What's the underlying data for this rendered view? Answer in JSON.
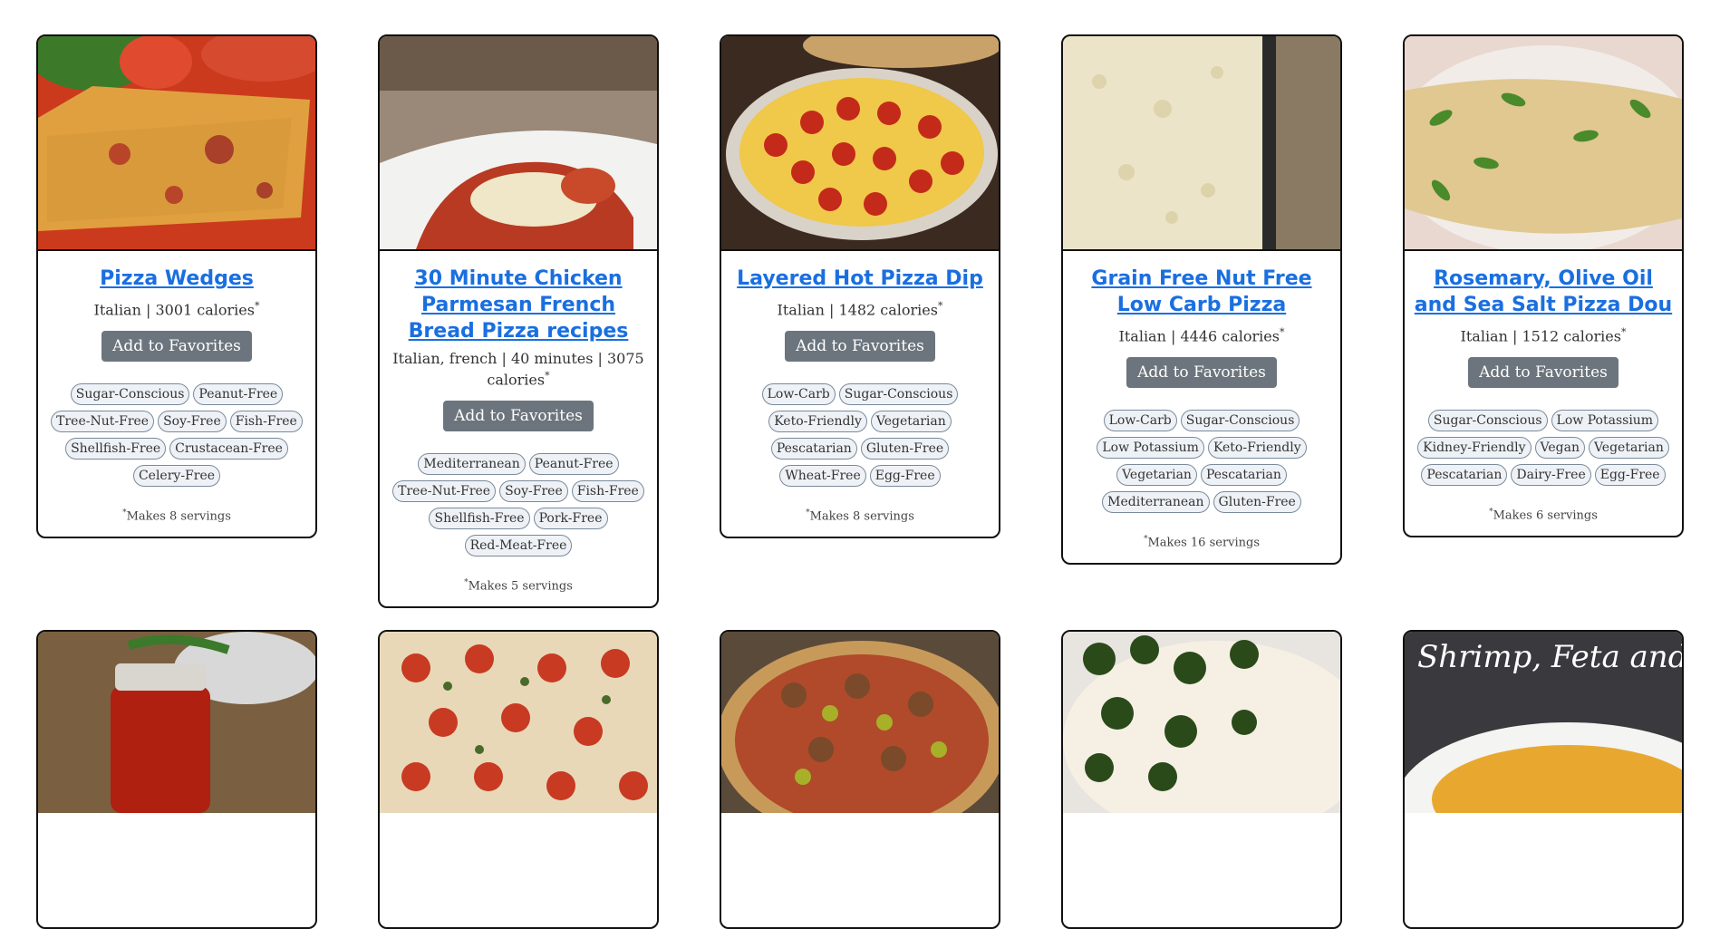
{
  "favorites_label": "Add to Favorites",
  "row1": [
    {
      "title": "Pizza Wedges",
      "meta": "Italian | 3001 calories",
      "tags": [
        "Sugar-Conscious",
        "Peanut-Free",
        "Tree-Nut-Free",
        "Soy-Free",
        "Fish-Free",
        "Shellfish-Free",
        "Crustacean-Free",
        "Celery-Free"
      ],
      "note": "Makes 8 servings"
    },
    {
      "title": "30 Minute Chicken Parmesan French Bread Pizza recipes",
      "meta": "Italian, french | 40 minutes | 3075 calories",
      "tags": [
        "Mediterranean",
        "Peanut-Free",
        "Tree-Nut-Free",
        "Soy-Free",
        "Fish-Free",
        "Shellfish-Free",
        "Pork-Free",
        "Red-Meat-Free"
      ],
      "note": "Makes 5 servings"
    },
    {
      "title": "Layered Hot Pizza Dip",
      "meta": "Italian | 1482 calories",
      "tags": [
        "Low-Carb",
        "Sugar-Conscious",
        "Keto-Friendly",
        "Vegetarian",
        "Pescatarian",
        "Gluten-Free",
        "Wheat-Free",
        "Egg-Free"
      ],
      "note": "Makes 8 servings"
    },
    {
      "title": "Grain Free Nut Free Low Carb Pizza",
      "meta": "Italian | 4446 calories",
      "tags": [
        "Low-Carb",
        "Sugar-Conscious",
        "Low Potassium",
        "Keto-Friendly",
        "Vegetarian",
        "Pescatarian",
        "Mediterranean",
        "Gluten-Free"
      ],
      "note": "Makes 16 servings"
    },
    {
      "title": "Rosemary, Olive Oil and Sea Salt Pizza Dou",
      "meta": "Italian | 1512 calories",
      "tags": [
        "Sugar-Conscious",
        "Low Potassium",
        "Kidney-Friendly",
        "Vegan",
        "Vegetarian",
        "Pescatarian",
        "Dairy-Free",
        "Egg-Free"
      ],
      "note": "Makes 6 servings"
    }
  ],
  "row2_overlay_text": "Shrimp, Feta and To"
}
